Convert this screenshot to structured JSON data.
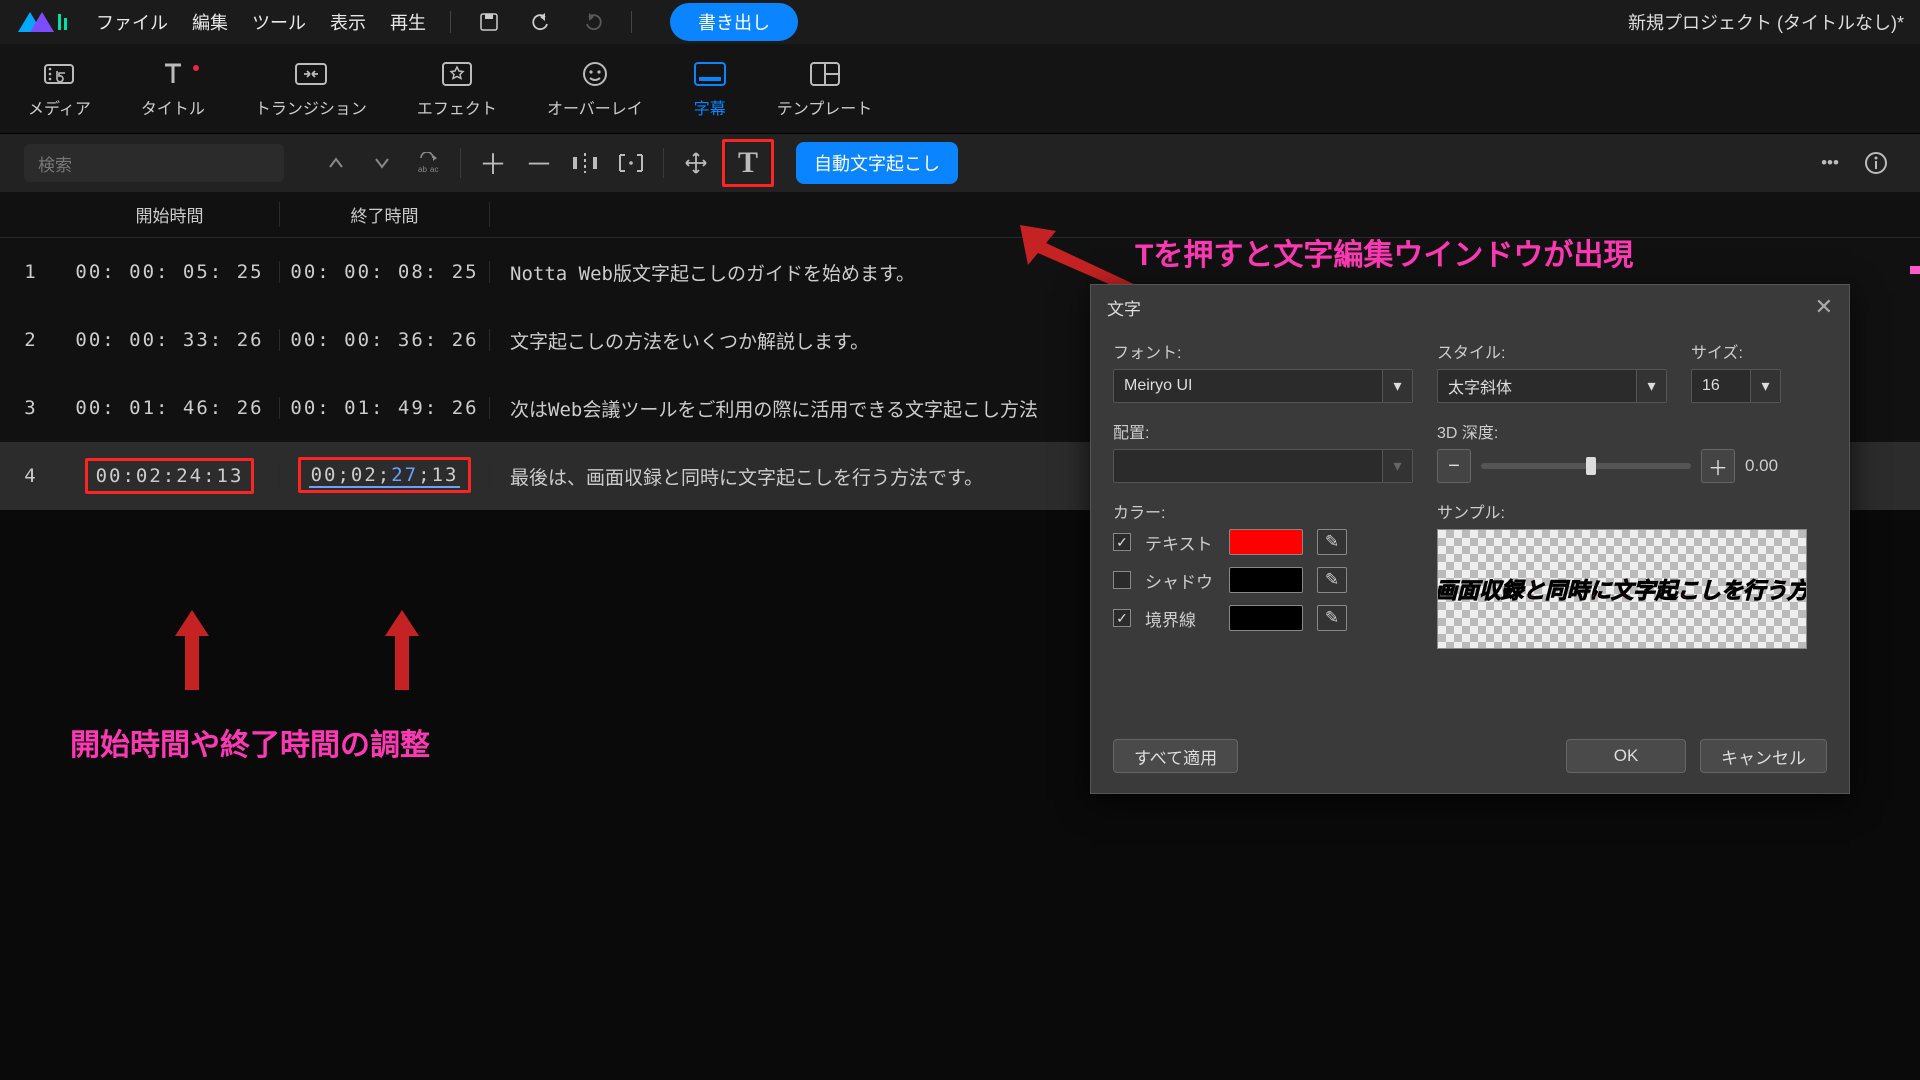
{
  "menubar": {
    "items": [
      "ファイル",
      "編集",
      "ツール",
      "表示",
      "再生"
    ],
    "export": "書き出し",
    "project_title": "新規プロジェクト (タイトルなし)*"
  },
  "ribbon": {
    "items": [
      {
        "label": "メディア",
        "active": false
      },
      {
        "label": "タイトル",
        "active": false,
        "dot": true
      },
      {
        "label": "トランジション",
        "active": false
      },
      {
        "label": "エフェクト",
        "active": false
      },
      {
        "label": "オーバーレイ",
        "active": false
      },
      {
        "label": "字幕",
        "active": true
      },
      {
        "label": "テンプレート",
        "active": false
      }
    ]
  },
  "sub_toolbar": {
    "search_placeholder": "検索",
    "auto_transcribe": "自動文字起こし",
    "text_tool_glyph": "T"
  },
  "subtitle_table": {
    "headers": {
      "start": "開始時間",
      "end": "終了時間"
    },
    "rows": [
      {
        "idx": "1",
        "start": "00: 00: 05: 25",
        "end": "00: 00: 08: 25",
        "text": "Notta Web版文字起こしのガイドを始めます。"
      },
      {
        "idx": "2",
        "start": "00: 00: 33: 26",
        "end": "00: 00: 36: 26",
        "text": "文字起こしの方法をいくつか解説します。"
      },
      {
        "idx": "3",
        "start": "00: 01: 46: 26",
        "end": "00: 01: 49: 26",
        "text": "次はWeb会議ツールをご利用の際に活用できる文字起こし方法"
      },
      {
        "idx": "4",
        "start": "00:02:24:13",
        "end_pre": "00;02;",
        "end_blue": "27",
        "end_post": ";13",
        "text": "最後は、画面収録と同時に文字起こしを行う方法です。"
      }
    ]
  },
  "annotations": {
    "time_adjust": "開始時間や終了時間の調整",
    "t_hint": "Tを押すと文字編集ウインドウが出現"
  },
  "dialog": {
    "title": "文字",
    "font_label": "フォント:",
    "font_value": "Meiryo UI",
    "style_label": "スタイル:",
    "style_value": "太字斜体",
    "size_label": "サイズ:",
    "size_value": "16",
    "align_label": "配置:",
    "align_placeholder": "",
    "depth_label": "3D 深度:",
    "depth_value": "0.00",
    "color_label": "カラー:",
    "sample_label": "サンプル:",
    "color_rows": [
      {
        "label": "テキスト",
        "checked": true,
        "color": "#ff0000"
      },
      {
        "label": "シャドウ",
        "checked": false,
        "color": "#000000"
      },
      {
        "label": "境界線",
        "checked": true,
        "color": "#000000"
      }
    ],
    "sample_text": "、画面収録と同時に文字起こしを行う方法",
    "apply_all": "すべて適用",
    "ok": "OK",
    "cancel": "キャンセル"
  }
}
